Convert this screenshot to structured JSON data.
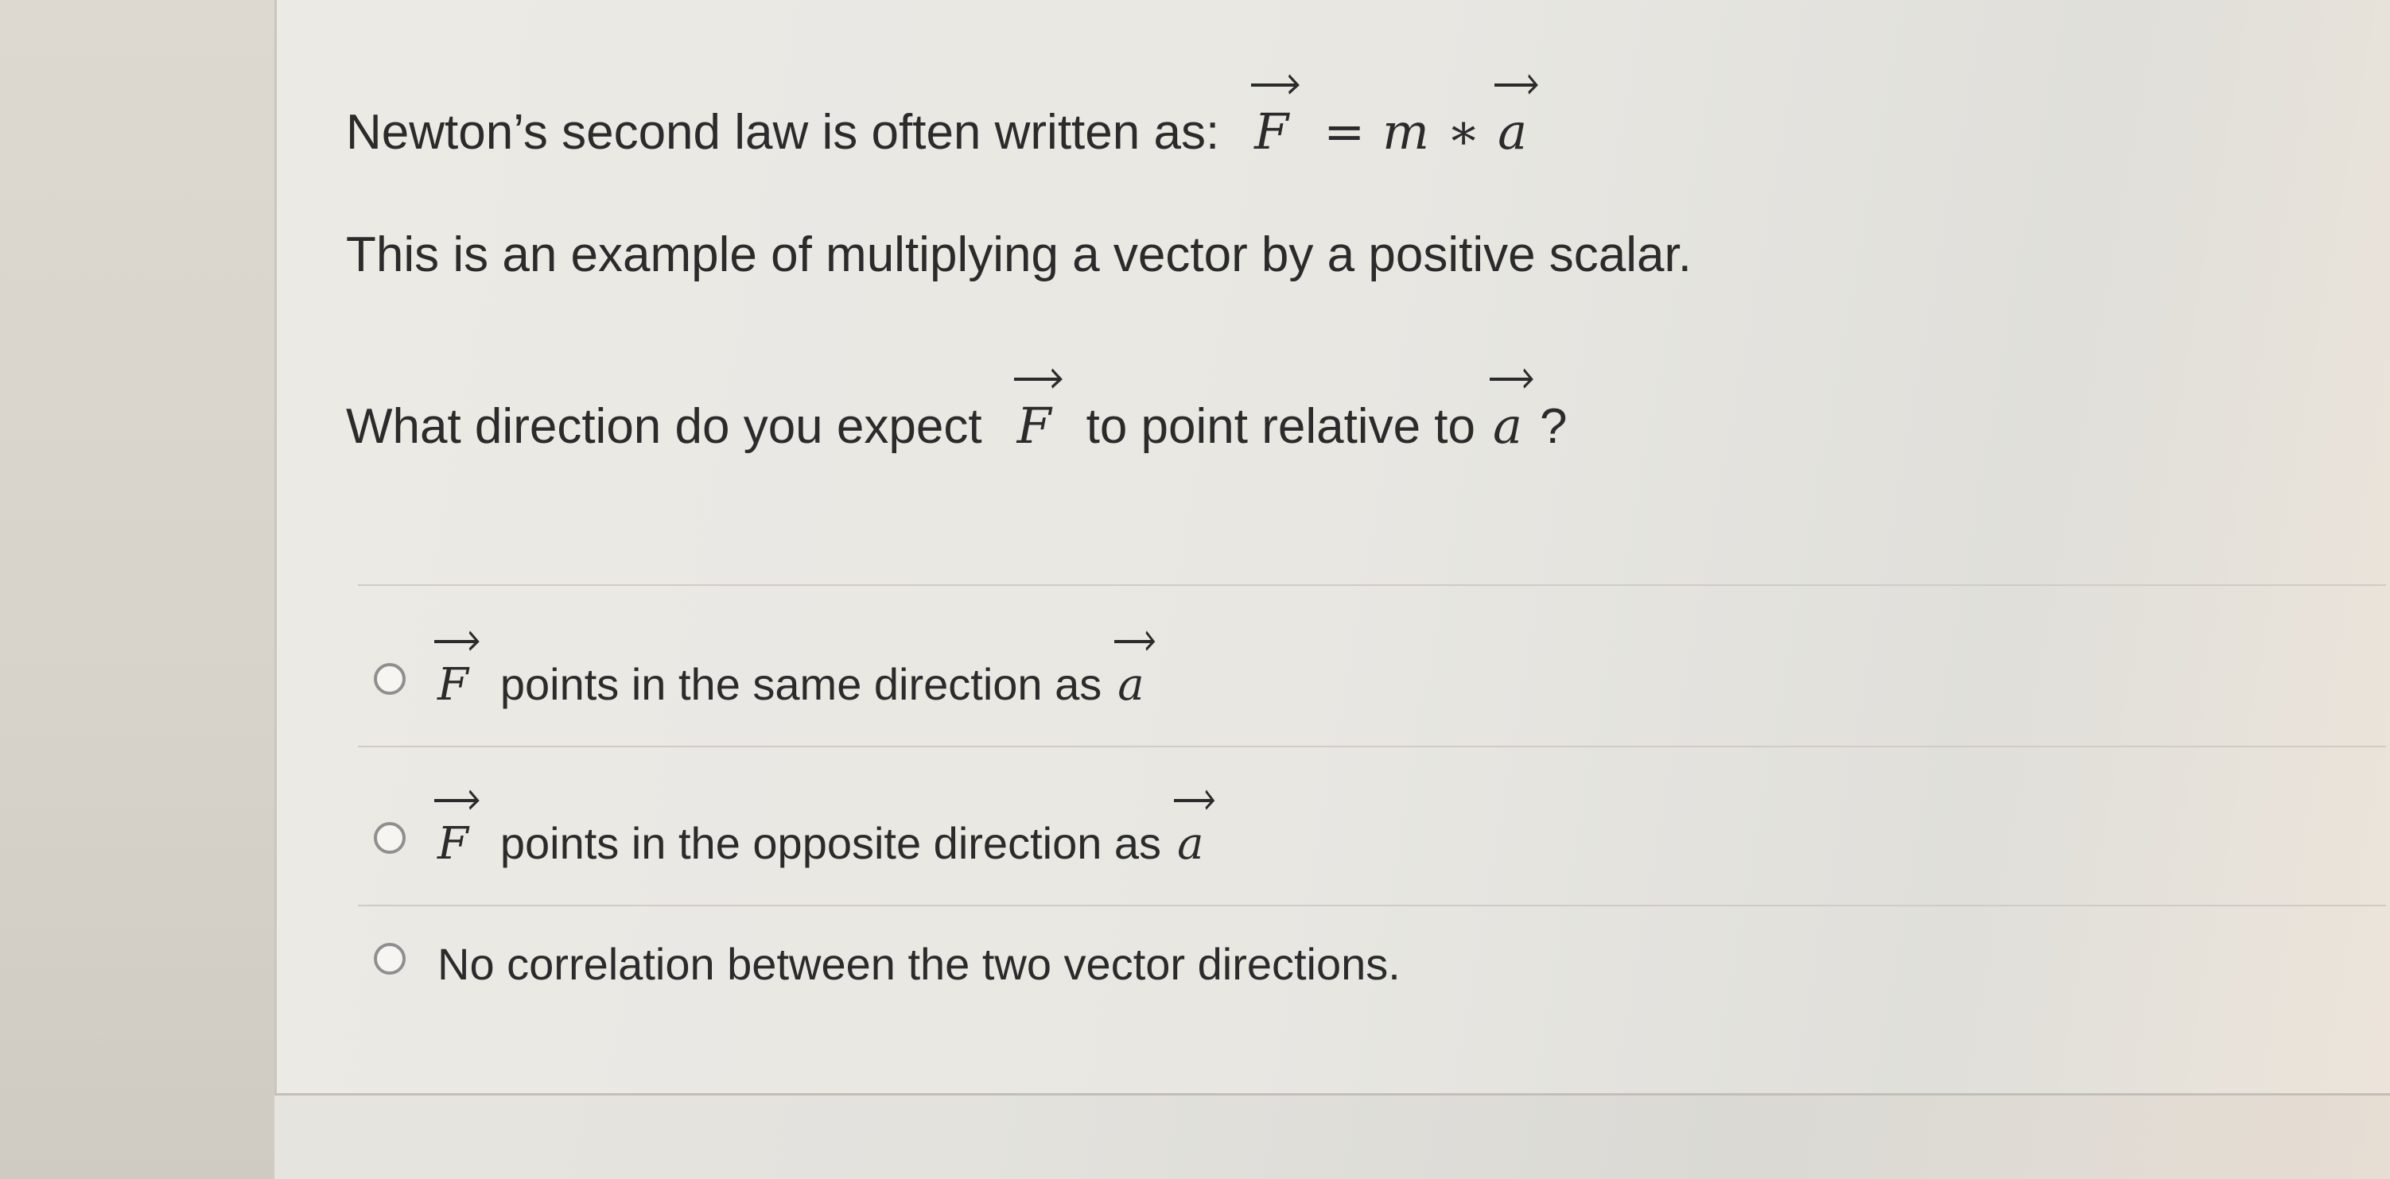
{
  "question": {
    "line1_text": "Newton’s second law is often written as:",
    "line1_math": {
      "lhs": "F",
      "equals": "=",
      "mass": "m",
      "times": "∗",
      "rhs": "a"
    },
    "line2_text": "This is an example of multiplying a vector by a positive scalar.",
    "line3_before": "What direction do you expect",
    "line3_vec1": "F",
    "line3_middle": "to point relative to",
    "line3_vec2": "a",
    "line3_after": "?"
  },
  "options": [
    {
      "vec1": "F",
      "text": "points in the same direction as",
      "vec2": "a"
    },
    {
      "vec1": "F",
      "text": "points in the opposite direction as",
      "vec2": "a"
    },
    {
      "text": "No correlation between the two vector directions."
    }
  ]
}
